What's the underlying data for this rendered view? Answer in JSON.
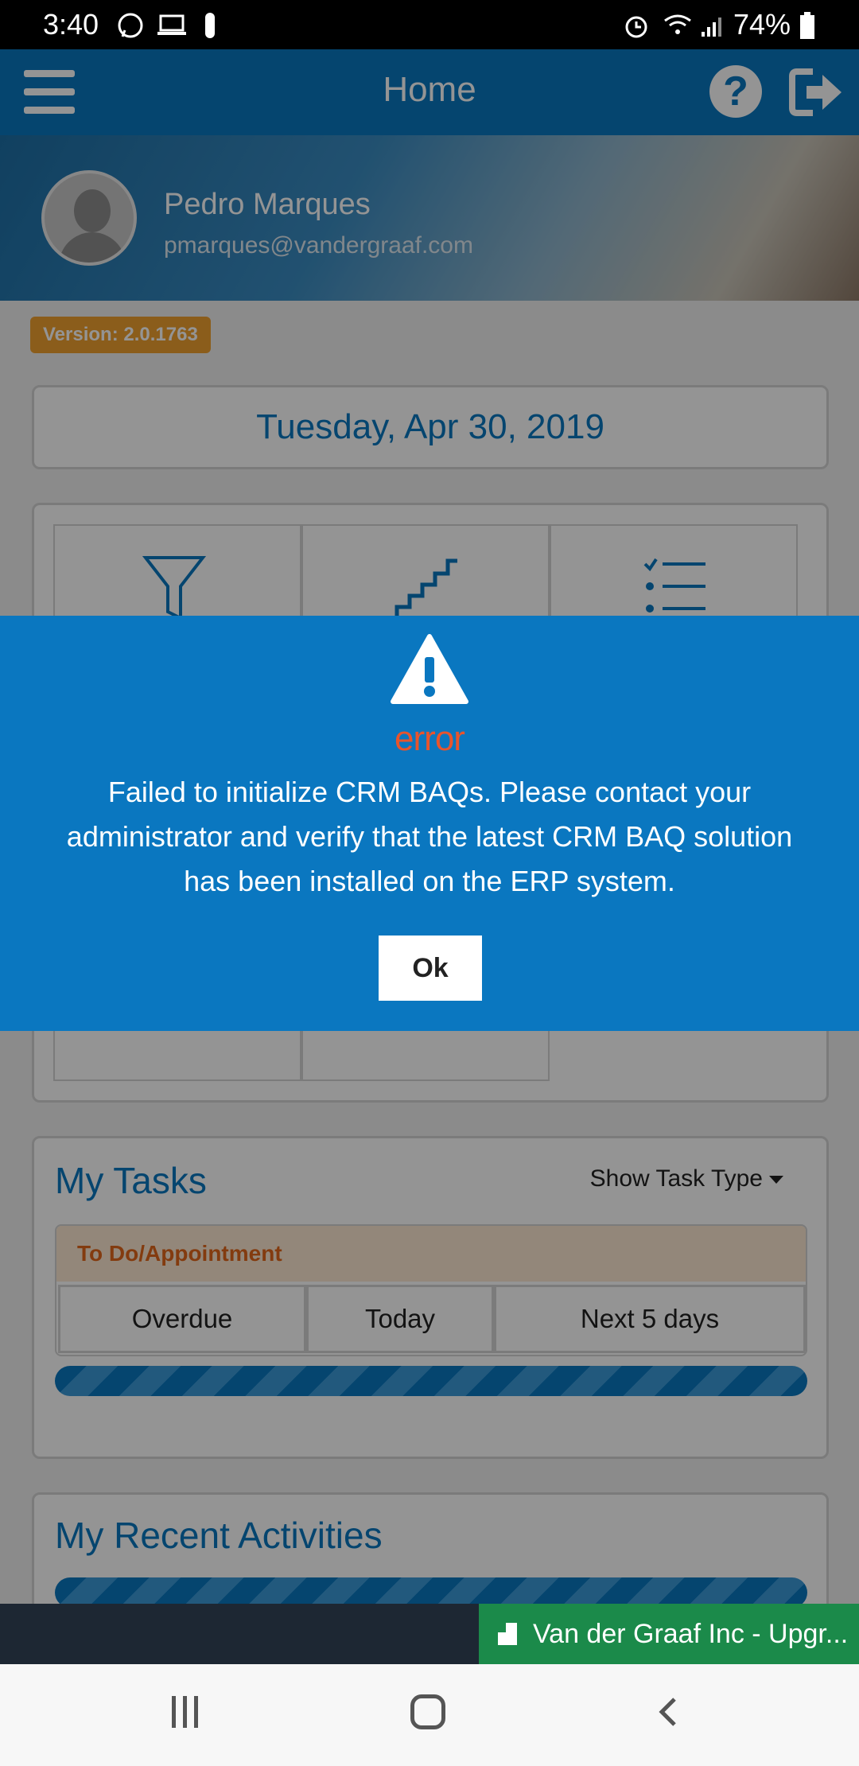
{
  "status_bar": {
    "time": "3:40",
    "battery": "74%",
    "icons": [
      "whatsapp-icon",
      "laptop-icon",
      "usb-icon",
      "alarm-icon",
      "wifi-icon",
      "signal-icon",
      "battery-icon"
    ]
  },
  "header": {
    "title": "Home",
    "menu_icon": "menu-icon",
    "help_icon": "help-icon",
    "logout_icon": "logout-icon"
  },
  "profile": {
    "name": "Pedro Marques",
    "email": "pmarques@vandergraaf.com"
  },
  "version": "Version: 2.0.1763",
  "date": "Tuesday, Apr 30, 2019",
  "tiles": {
    "icons": [
      "funnel-icon",
      "stairs-icon",
      "checklist-icon"
    ]
  },
  "tasks": {
    "title": "My Tasks",
    "show_task_type": "Show Task Type",
    "category": "To Do/Appointment",
    "segments": [
      "Overdue",
      "Today",
      "Next 5 days"
    ]
  },
  "activities": {
    "title": "My Recent Activities"
  },
  "taskbar": {
    "app_label": "Van der Graaf Inc - Upgr..."
  },
  "dialog": {
    "title": "error",
    "message": "Failed to initialize CRM BAQs. Please contact your administrator and verify that the latest CRM BAQ solution has been installed on the ERP system.",
    "ok_label": "Ok"
  },
  "colors": {
    "primary": "#0a77c0",
    "error": "#e8542c",
    "version_badge": "#f0a030",
    "todo_text": "#e2671a",
    "taskbar_app": "#1b8a4a"
  }
}
